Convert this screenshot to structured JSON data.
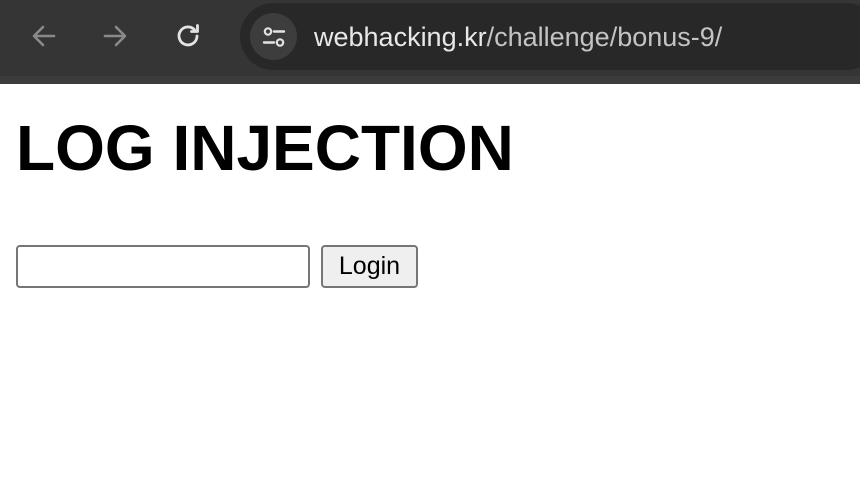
{
  "browser": {
    "url_host": "webhacking.kr",
    "url_path": "/challenge/bonus-9/",
    "icons": {
      "back": "arrow-left-icon",
      "forward": "arrow-right-icon",
      "reload": "reload-icon",
      "site_info": "tune-icon"
    }
  },
  "page": {
    "title": "LOG INJECTION",
    "login_input": {
      "value": "",
      "placeholder": ""
    },
    "login_button_label": "Login"
  }
}
